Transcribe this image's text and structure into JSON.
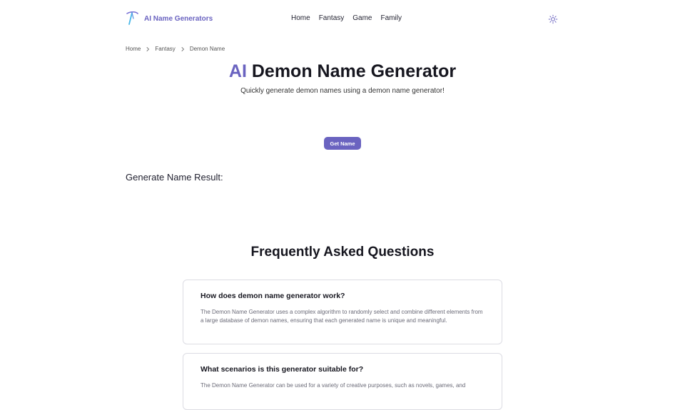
{
  "header": {
    "brand": "AI Name Generators",
    "nav": [
      "Home",
      "Fantasy",
      "Game",
      "Family"
    ],
    "theme_icon": "sun-icon"
  },
  "breadcrumb": [
    "Home",
    "Fantasy",
    "Demon Name"
  ],
  "hero": {
    "title_accent": "AI",
    "title_rest": "Demon Name Generator",
    "subtitle": "Quickly generate demon names using a demon name generator!"
  },
  "action": {
    "button_label": "Get Name"
  },
  "result": {
    "label": "Generate Name Result:"
  },
  "faq": {
    "title": "Frequently Asked Questions",
    "items": [
      {
        "q": "How does demon name generator work?",
        "a": "The Demon Name Generator uses a complex algorithm to randomly select and combine different elements from a large database of demon names, ensuring that each generated name is unique and meaningful."
      },
      {
        "q": "What scenarios is this generator suitable for?",
        "a": "The Demon Name Generator can be used for a variety of creative purposes, such as novels, games, and"
      }
    ]
  },
  "colors": {
    "accent": "#6a63c0",
    "text": "#16161f",
    "muted": "#6b6b78",
    "border": "#dcdce3"
  }
}
